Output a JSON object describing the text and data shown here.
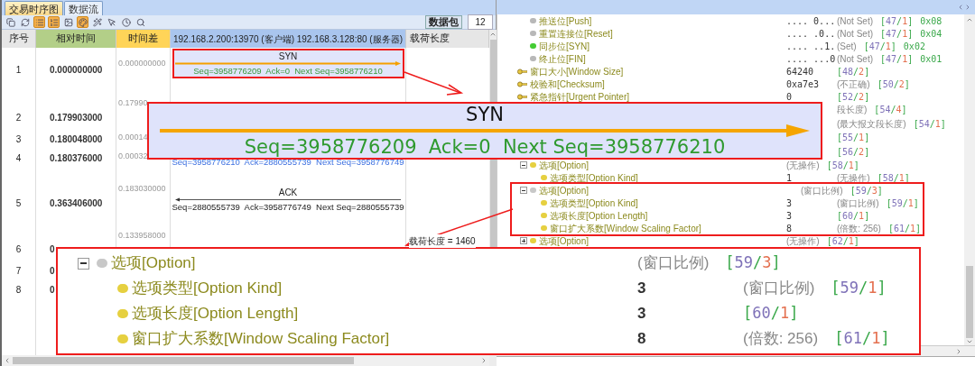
{
  "tabs": [
    {
      "label": "交易时序图",
      "selected": true
    },
    {
      "label": "数据流",
      "selected": false
    }
  ],
  "toolbar": [
    {
      "kind": "copy",
      "selected": false
    },
    {
      "kind": "refresh",
      "selected": false
    },
    {
      "kind": "list",
      "selected": true
    },
    {
      "kind": "ordered-list",
      "selected": true
    },
    {
      "kind": "image",
      "selected": false
    },
    {
      "kind": "palette",
      "selected": true
    },
    {
      "kind": "wand",
      "selected": false
    },
    {
      "kind": "pointer",
      "selected": false
    },
    {
      "kind": "clock",
      "selected": false
    },
    {
      "kind": "search",
      "selected": false
    }
  ],
  "packet_count": {
    "label": "数据包",
    "value": "12"
  },
  "table": {
    "columns": [
      {
        "label": "序号",
        "color": "#e6e6e6"
      },
      {
        "label": "相对时间",
        "color": "#b3cf88"
      },
      {
        "label": "时间差",
        "color": "#ffd458"
      },
      {
        "kind": "flow",
        "client": "192.168.2.200:13970 (客户端)",
        "server": "192.168.3.128:80 (服务器)",
        "color": "#a9c5ee"
      },
      {
        "label": "载荷长度",
        "color": "#e6e6e6"
      }
    ],
    "rows": [
      {
        "no": "1",
        "rel": "0.000000000",
        "diff": "0.000000000",
        "message": {
          "kind": "request",
          "label": "SYN",
          "detail": "Seq=3958776209  Ack=0  Next Seq=3958776210",
          "marked": true
        }
      },
      {
        "no": "2",
        "rel": "0.179903000",
        "diff": "0.17990"
      },
      {
        "no": "3",
        "rel": "0.180048000",
        "diff": "0.00014"
      },
      {
        "no": "4",
        "rel": "0.180376000",
        "diff": "0.00032",
        "message": {
          "kind": "partial",
          "detail": "Seq=3958776210  Ack=2880555739  Next Seq=3958776749",
          "marked": false
        }
      },
      {
        "no": "5",
        "rel": "0.363406000",
        "diff": "0.183030000",
        "message": {
          "kind": "response",
          "label": "ACK",
          "detail": "Seq=2880555739  Ack=3958776749  Next Seq=2880555739",
          "marked": false
        }
      },
      {
        "no": "6",
        "rel": "0",
        "diff": "0.133958000",
        "payload": "载荷长度 = 1460"
      },
      {
        "no": "7",
        "rel": "0"
      },
      {
        "no": "8",
        "rel": "0"
      }
    ]
  },
  "tree": [
    {
      "kind": "flag",
      "name": "推送位[Push]",
      "value": ".... 0...",
      "note": "(Not Set)",
      "ref": "[47/1]",
      "hex": "0x08",
      "color": "#b8b8b8"
    },
    {
      "kind": "flag",
      "name": "重置连接位[Reset]",
      "value": ".... .0..",
      "note": "(Not Set)",
      "ref": "[47/1]",
      "hex": "0x04",
      "color": "#b8b8b8"
    },
    {
      "kind": "flag",
      "name": "同步位[SYN]",
      "value": ".... ..1.",
      "note": "(Set)",
      "ref": "[47/1]",
      "hex": "0x02",
      "color": "#44cc33"
    },
    {
      "kind": "flag",
      "name": "终止位[FIN]",
      "value": ".... ...0",
      "note": "(Not Set)",
      "ref": "[47/1]",
      "hex": "0x01",
      "color": "#b8b8b8"
    },
    {
      "kind": "field",
      "name": "窗口大小[Window Size]",
      "value": "64240",
      "ref": "[48/2]"
    },
    {
      "kind": "field",
      "name": "校验和[Checksum]",
      "value": "0xa7e3",
      "note": "(不正确)",
      "ref": "[50/2]"
    },
    {
      "kind": "field",
      "name": "紧急指针[Urgent Pointer]",
      "value": "0",
      "ref": "[52/2]"
    },
    {
      "kind": "hidden",
      "note": "段长度)",
      "ref": "[54/4]"
    },
    {
      "kind": "hidden",
      "note": "(最大报文段长度)",
      "ref": "[54/1]"
    },
    {
      "kind": "hidden",
      "ref": "[55/1]"
    },
    {
      "kind": "hidden",
      "ref": "[56/2]"
    },
    {
      "kind": "group",
      "name": "选项[Option]",
      "note": "(无操作)",
      "ref": "[58/1]",
      "color": "#e6d040",
      "expanded": true,
      "marked": false,
      "children": [
        {
          "kind": "item",
          "name": "选项类型[Option Kind]",
          "value": "1",
          "note": "(无操作)",
          "ref": "[58/1]",
          "color": "#e6d040"
        }
      ]
    },
    {
      "kind": "group",
      "name": "选项[Option]",
      "note": "(窗口比例)",
      "ref": "[59/3]",
      "color": "#c8c8c8",
      "expanded": true,
      "marked": true,
      "children": [
        {
          "kind": "item",
          "name": "选项类型[Option Kind]",
          "value": "3",
          "note": "(窗口比例)",
          "ref": "[59/1]",
          "color": "#e6d040"
        },
        {
          "kind": "item",
          "name": "选项长度[Option Length]",
          "value": "3",
          "ref": "[60/1]",
          "color": "#e6d040"
        },
        {
          "kind": "item",
          "name": "窗口扩大系数[Window Scaling Factor]",
          "value": "8",
          "note": "(倍数: 256)",
          "ref": "[61/1]",
          "color": "#e6d040"
        }
      ]
    },
    {
      "kind": "group",
      "name": "选项[Option]",
      "note": "(无操作)",
      "ref": "[62/1]",
      "color": "#e6d040",
      "expanded": false,
      "marked": false
    }
  ],
  "callouts": [
    {
      "kind": "message",
      "label": "SYN",
      "detail": "Seq=3958776209  Ack=0  Next Seq=3958776210"
    },
    {
      "kind": "tree",
      "name": "选项[Option]",
      "note": "(窗口比例)",
      "ref": "[59/3]",
      "color": "#c8c8c8",
      "expanded": true,
      "children": [
        {
          "name": "选项类型[Option Kind]",
          "value": "3",
          "note": "(窗口比例)",
          "ref": "[59/1]",
          "color": "#e6d040"
        },
        {
          "name": "选项长度[Option Length]",
          "value": "3",
          "ref": "[60/1]",
          "color": "#e6d040"
        },
        {
          "name": "窗口扩大系数[Window Scaling Factor]",
          "value": "8",
          "note": "(倍数: 256)",
          "ref": "[61/1]",
          "color": "#e6d040"
        }
      ]
    }
  ]
}
